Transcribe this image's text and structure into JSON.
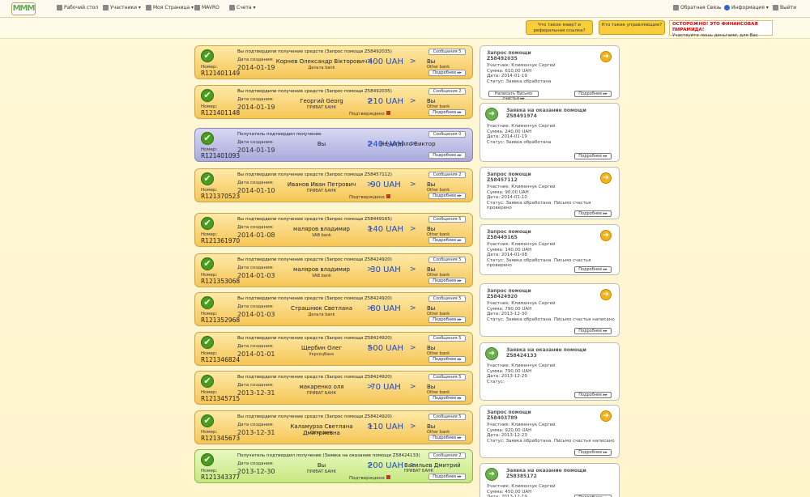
{
  "header": {
    "logo": "MMM",
    "nav": [
      "Рабочий стол",
      "Участники ▾",
      "Моя Страница ▾",
      "MAVRO",
      "Счета ▾"
    ],
    "right": [
      "Обратная Связь",
      "Информация ▾",
      "Выйти"
    ]
  },
  "subbar": {
    "btn1": "Что такое мавр? и реферальная ссылка?",
    "btn2": "Кто такие управляющие?",
    "warning_red": "ОСТОРОЖНО! ЭТО ФИНАНСОВАЯ ПИРАМИДА!",
    "warning_text": "Участвуйте лишь деньгами, для Вас некритичными!"
  },
  "labels": {
    "num": "Номер:",
    "date": "Дата создания:",
    "messages": "Сообщения",
    "more": "Подробнее ▸▸",
    "confirmed": "Подтверждено"
  },
  "cards": [
    {
      "style": "yellow",
      "head": "Вы подтвердили получение средств (Запрос помощи Z58492035)",
      "msgs": "5",
      "number": "R121401149",
      "date": "2014-01-19",
      "from": "Корнев Олександр Вікторович",
      "from_bank": "Дельта bank",
      "amount": "400 UAH",
      "to": "Вы",
      "to_bank": "Other bank",
      "confirm": ""
    },
    {
      "style": "yellow",
      "head": "Вы подтвердили получение средств (Запрос помощи Z58492035)",
      "msgs": "2",
      "number": "R121401148",
      "date": "2014-01-19",
      "from": "Георгий Georg",
      "from_bank": "ПРИВАТ БАНК",
      "amount": "210 UAH",
      "to": "Вы",
      "to_bank": "Other bank",
      "confirm": "Подтверждено"
    },
    {
      "style": "blue",
      "head": "Получатель подтвердил получение",
      "msgs": "0",
      "number": "R121401093",
      "date": "2014-01-19",
      "from": "Вы",
      "from_bank": "",
      "amount": "240 UAH",
      "to": "Нечитайло Виктор",
      "to_bank": "",
      "confirm": ""
    },
    {
      "style": "yellow",
      "head": "Вы подтвердили получение средств (Запрос помощи Z58457112)",
      "msgs": "2",
      "number": "R121370523",
      "date": "2014-01-10",
      "from": "Иванов Иван Петрович",
      "from_bank": "ПРИВАТ БАНК",
      "amount": "90 UAH",
      "to": "Вы",
      "to_bank": "Other bank",
      "confirm": "Подтверждено"
    },
    {
      "style": "yellow",
      "head": "Вы подтвердили получение средств (Запрос помощи Z58449165)",
      "msgs": "5",
      "number": "R121361970",
      "date": "2014-01-08",
      "from": "маляров владимир",
      "from_bank": "VAB bank",
      "amount": "140 UAH",
      "to": "Вы",
      "to_bank": "Other bank",
      "confirm": ""
    },
    {
      "style": "yellow",
      "head": "Вы подтвердили получение средств (Запрос помощи Z58424920)",
      "msgs": "5",
      "number": "R121353068",
      "date": "2014-01-03",
      "from": "маляров владимир",
      "from_bank": "VAB bank",
      "amount": "30 UAH",
      "to": "Вы",
      "to_bank": "Other bank",
      "confirm": ""
    },
    {
      "style": "yellow",
      "head": "Вы подтвердили получение средств (Запрос помощи Z58424920)",
      "msgs": "5",
      "number": "R121352968",
      "date": "2014-01-03",
      "from": "Страшнюк Светлана",
      "from_bank": "Дельта bank",
      "amount": "80 UAH",
      "to": "Вы",
      "to_bank": "Other bank",
      "confirm": ""
    },
    {
      "style": "yellow",
      "head": "Вы подтвердили получение средств (Запрос помощи Z58424920)",
      "msgs": "5",
      "number": "R121346824",
      "date": "2014-01-01",
      "from": "Щербин Олег",
      "from_bank": "Укрсоцбанк",
      "amount": "500 UAH",
      "to": "Вы",
      "to_bank": "Other bank",
      "confirm": ""
    },
    {
      "style": "yellow",
      "head": "Вы подтвердили получение средств (Запрос помощи Z58424920)",
      "msgs": "5",
      "number": "R121345715",
      "date": "2013-12-31",
      "from": "макаренко оля",
      "from_bank": "ПРИВАТ БАНК",
      "amount": "70 UAH",
      "to": "Вы",
      "to_bank": "Other bank",
      "confirm": ""
    },
    {
      "style": "yellow",
      "head": "Вы подтвердили получение средств (Запрос помощи Z58424920)",
      "msgs": "5",
      "number": "R121345673",
      "date": "2013-12-31",
      "from": "Каламурза Светлана Дмитриевна",
      "from_bank": "Other bank",
      "amount": "110 UAH",
      "to": "Вы",
      "to_bank": "Other bank",
      "confirm": ""
    },
    {
      "style": "green",
      "head": "Получатель подтвердил получение (Заявка на оказание помощи Z58424133)",
      "msgs": "2",
      "number": "R121343377",
      "date": "2013-12-30",
      "from": "Вы",
      "from_bank": "ПРИВАТ БАНК",
      "amount": "200 UAH",
      "to": "Васильев Дмитрий",
      "to_bank": "ПРИВАТ БАНК",
      "confirm": "Подтверждено"
    }
  ],
  "side_labels": {
    "member": "Участник:",
    "sum": "Сумма:",
    "date": "Дата:",
    "status": "Статус:",
    "write": "Написать Письмо счастья ▸▸"
  },
  "side": [
    {
      "kind": "request",
      "title": "Запрос помощи",
      "id": "Z58492035",
      "member": "Клименчук Сергей",
      "sum": "610,00 UAH",
      "date": "2014-01-19",
      "status": "Заявка обработана",
      "write": true
    },
    {
      "kind": "offer",
      "title": "Заявка на оказание помощи",
      "id": "Z58491974",
      "member": "Клименчук Сергей",
      "sum": "240,00 UAH",
      "date": "2014-01-19",
      "status": "Заявка обработана",
      "write": false
    },
    {
      "kind": "request",
      "title": "Запрос помощи",
      "id": "Z58457112",
      "member": "Клименчук Сергей",
      "sum": "90,00 UAH",
      "date": "2014-01-10",
      "status": "Заявка обработана. Письмо счастья проверено",
      "write": false
    },
    {
      "kind": "request",
      "title": "Запрос помощи",
      "id": "Z58449165",
      "member": "Клименчук Сергей",
      "sum": "140,00 UAH",
      "date": "2014-01-08",
      "status": "Заявка обработана. Письмо счастья проверено",
      "write": false
    },
    {
      "kind": "request",
      "title": "Запрос помощи",
      "id": "Z58424920",
      "member": "Клименчук Сергей",
      "sum": "790,00 UAH",
      "date": "2013-12-30",
      "status": "Заявка обработана. Письмо счастья написано",
      "write": false
    },
    {
      "kind": "offer",
      "title": "Заявка на оказание помощи",
      "id": "Z58424133",
      "member": "Клименчук Сергей",
      "sum": "790,00 UAH",
      "date": "2013-12-29",
      "status": "",
      "write": false
    },
    {
      "kind": "request",
      "title": "Запрос помощи",
      "id": "Z58403789",
      "member": "Клименчук Сергей",
      "sum": "920,00 UAH",
      "date": "2013-12-23",
      "status": "Заявка обработана. Письмо счастья написано",
      "write": false
    },
    {
      "kind": "offer",
      "title": "Заявка на оказание помощи",
      "id": "Z58385172",
      "member": "Клименчук Сергей",
      "sum": "450,00 UAH",
      "date": "2013-12-19",
      "status": "",
      "write": false
    }
  ]
}
